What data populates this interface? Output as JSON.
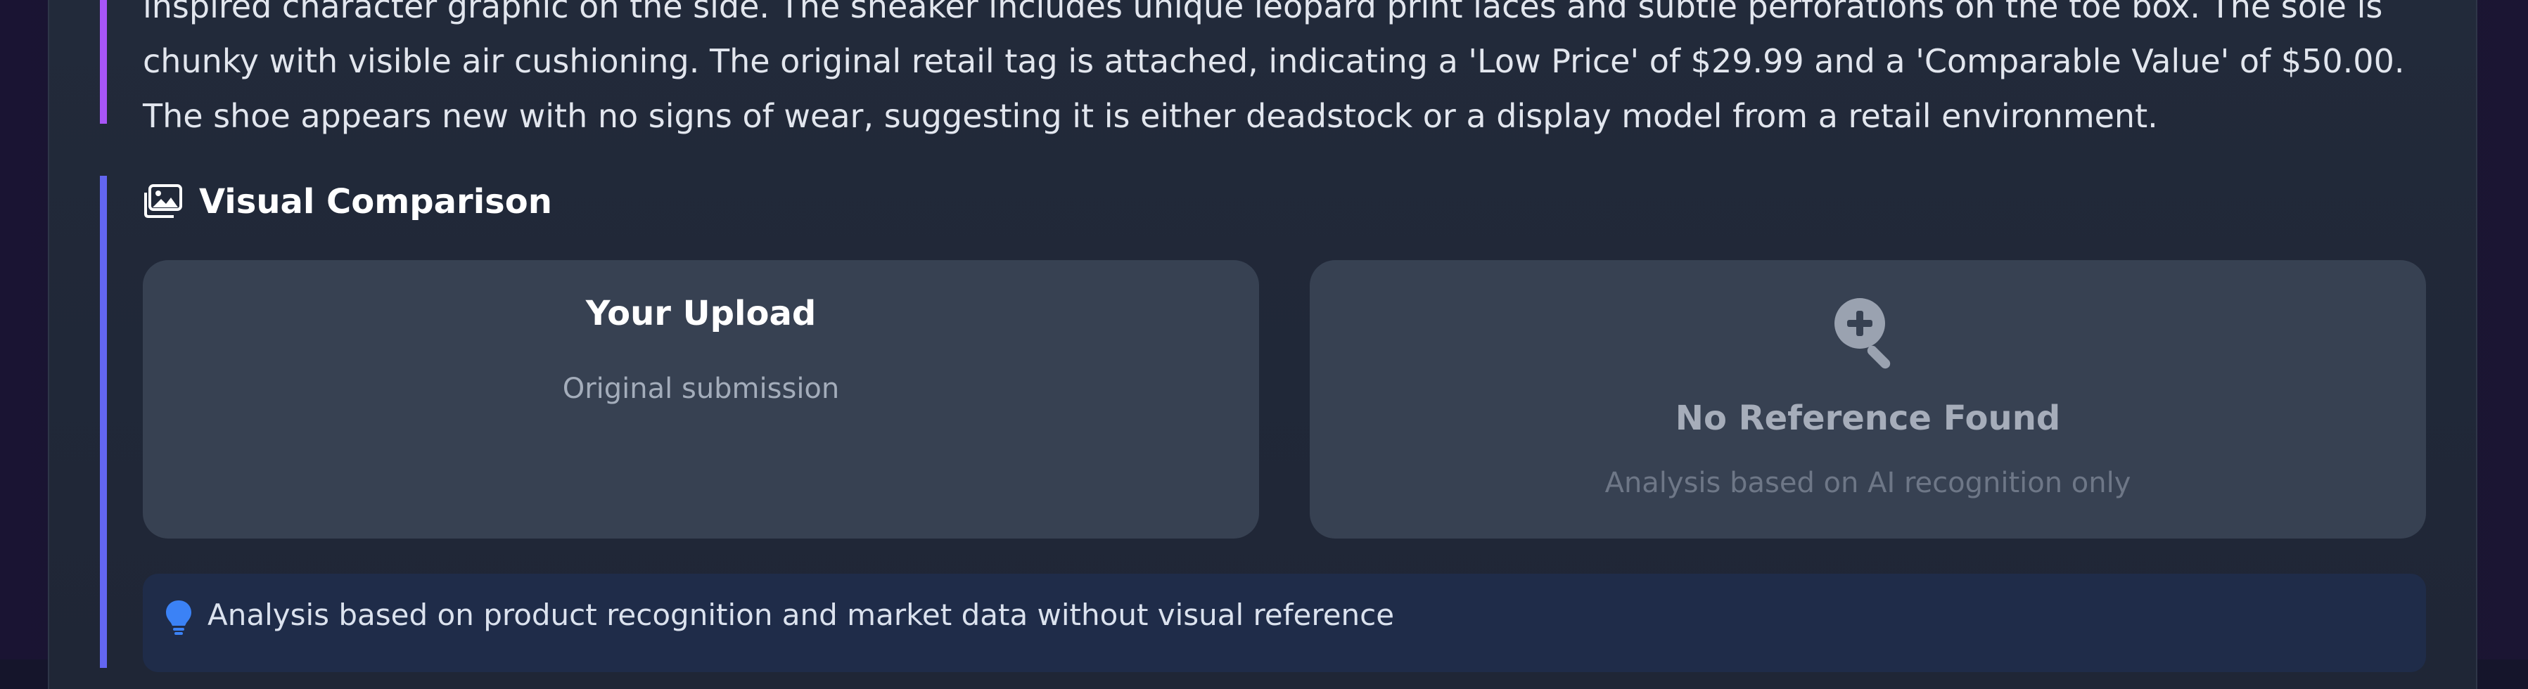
{
  "description": {
    "text": "inspired character graphic on the side. The sneaker includes unique leopard print laces and subtle perforations on the toe box. The sole is chunky with visible air cushioning. The original retail tag is attached, indicating a 'Low Price' of $29.99 and a 'Comparable Value' of $50.00. The shoe appears new with no signs of wear, suggesting it is either deadstock or a display model from a retail environment.",
    "accent_color": "#a855f7"
  },
  "visual_comparison": {
    "title": "Visual Comparison",
    "icon": "images-icon",
    "accent_color": "#6366f1",
    "upload_card": {
      "title": "Your Upload",
      "subtitle": "Original submission"
    },
    "reference_card": {
      "icon": "search-plus-icon",
      "title": "No Reference Found",
      "subtitle": "Analysis based on AI recognition only"
    },
    "note": {
      "icon": "lightbulb-icon",
      "text": "Analysis based on product recognition and market data without visual reference"
    }
  }
}
